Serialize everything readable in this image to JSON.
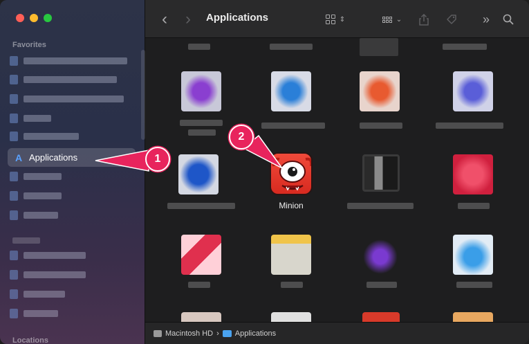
{
  "window": {
    "title": "Applications",
    "traffic_lights": [
      "#ff5f57",
      "#febc2e",
      "#28c840"
    ]
  },
  "sidebar": {
    "sections": [
      {
        "title": "Favorites"
      },
      {
        "title": "Locations"
      }
    ],
    "selected_item": {
      "label": "Applications",
      "icon": "app-store-a-icon"
    }
  },
  "toolbar": {
    "back_icon": "‹",
    "forward_icon": "›",
    "title": "Applications",
    "more_icon": "»",
    "search_icon": "search-icon"
  },
  "content": {
    "highlighted_app": {
      "label": "Minion",
      "icon": "minion-app-icon"
    }
  },
  "pathbar": {
    "items": [
      "Macintosh HD",
      "Applications"
    ],
    "separator": "›"
  },
  "annotations": {
    "badge_1": "1",
    "badge_2": "2",
    "accent": "#e8245d"
  }
}
